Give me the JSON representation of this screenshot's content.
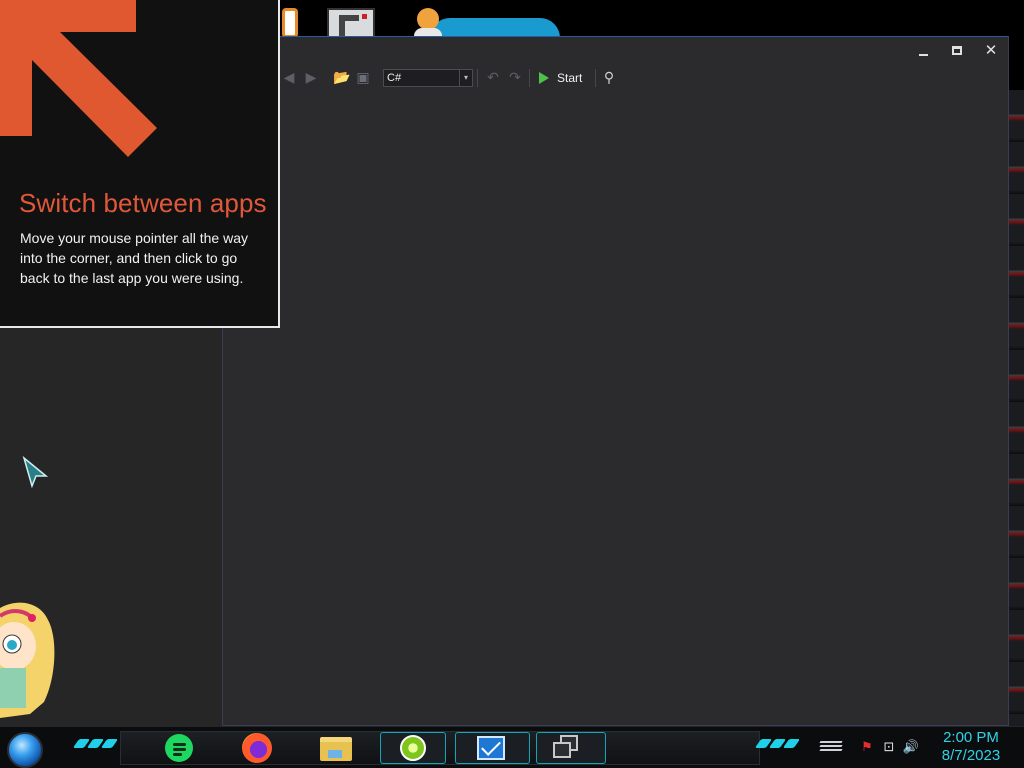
{
  "tip": {
    "title": "Switch between apps",
    "body": "Move your mouse pointer all the way into the corner, and then click to go back to the last app you were using."
  },
  "toolbar": {
    "language_value": "C#",
    "start_label": "Start"
  },
  "window_controls": {
    "minimize": "minimize",
    "maximize": "maximize",
    "close": "✕"
  },
  "clock": {
    "time": "2:00 PM",
    "date": "8/7/2023"
  },
  "taskbar": {
    "apps": [
      "messaging-app",
      "firefox",
      "file-explorer",
      "lime-app",
      "mail",
      "task-view"
    ]
  },
  "icons": {
    "back": "◀",
    "forward": "▶",
    "open": "📂",
    "save": "▣",
    "undo": "↶",
    "redo": "↷",
    "search": "⚲",
    "caret": "▾",
    "flag": "⚑",
    "network": "⊡",
    "volume": "🔊"
  },
  "colors": {
    "tip_title": "#e0583a",
    "tip_arrow": "#e0582f",
    "clock": "#2fd3e8",
    "start_play": "#4cc24a",
    "taskbar_accent": "#1fd0e8"
  }
}
